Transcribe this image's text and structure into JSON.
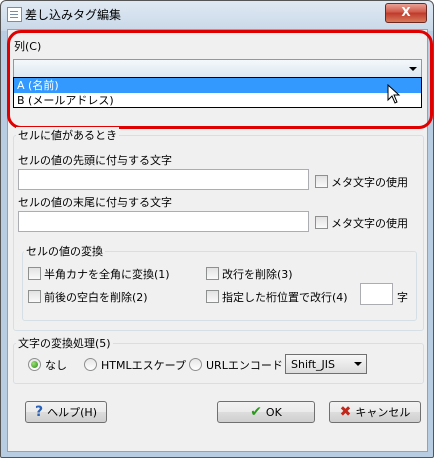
{
  "window": {
    "title": "差し込みタグ編集",
    "close_label": "X"
  },
  "column": {
    "label": "列(C)",
    "selected_value": "",
    "options": [
      "A (名前)",
      "B (メールアドレス)"
    ]
  },
  "when_value": {
    "group_label": "セルに値があるとき",
    "prefix": {
      "label": "セルの値の先頭に付与する文字",
      "value": "",
      "meta_label": "メタ文字の使用"
    },
    "suffix": {
      "label": "セルの値の末尾に付与する文字",
      "value": "",
      "meta_label": "メタ文字の使用"
    },
    "convert": {
      "group_label": "セルの値の変換",
      "halfwidth_kana": "半角カナを全角に変換(1)",
      "remove_newline": "改行を削除(3)",
      "trim_spaces": "前後の空白を削除(2)",
      "wrap_at": "指定した桁位置で改行(4)",
      "wrap_value": "",
      "wrap_unit": "字"
    }
  },
  "escape": {
    "group_label": "文字の変換処理(5)",
    "options": [
      "なし",
      "HTMLエスケープ",
      "URLエンコード"
    ],
    "selected": "なし",
    "encoding": "Shift_JIS"
  },
  "buttons": {
    "help": "ヘルプ(H)",
    "ok": "OK",
    "cancel": "キャンセル"
  },
  "colors": {
    "highlight_ring": "#e00000",
    "selection": "#3399ff"
  }
}
